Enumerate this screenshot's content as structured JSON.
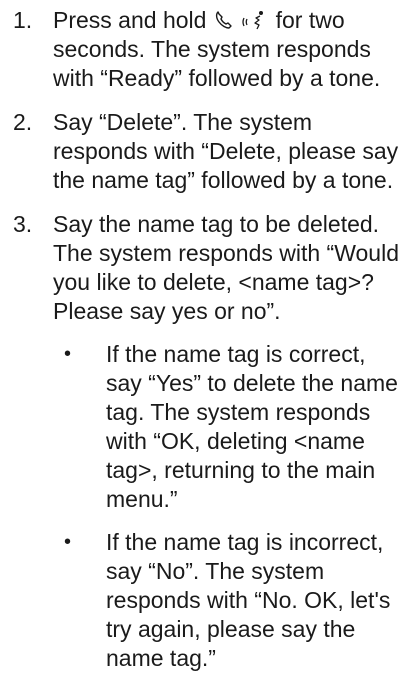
{
  "steps": [
    {
      "number": "1.",
      "text_before_icons": "Press and hold ",
      "icons": [
        "phone-handset-icon",
        "voice-command-icon"
      ],
      "text_after_icons": " for two seconds. The system responds with “Ready” followed by a tone."
    },
    {
      "number": "2.",
      "text": "Say “Delete”. The system responds with “Delete, please say the name tag” followed by a tone."
    },
    {
      "number": "3.",
      "text": "Say the name tag to be deleted. The system responds with “Would you like to delete, <name tag>? Please say yes or no”.",
      "bullets": [
        {
          "marker": "•",
          "text": "If the name tag is correct, say “Yes” to delete the name tag. The system responds with “OK, deleting <name tag>, returning to the main menu.”"
        },
        {
          "marker": "•",
          "text": "If the name tag is incorrect, say “No”. The system responds with “No. OK, let's try again, please say the name tag.”"
        }
      ]
    }
  ]
}
